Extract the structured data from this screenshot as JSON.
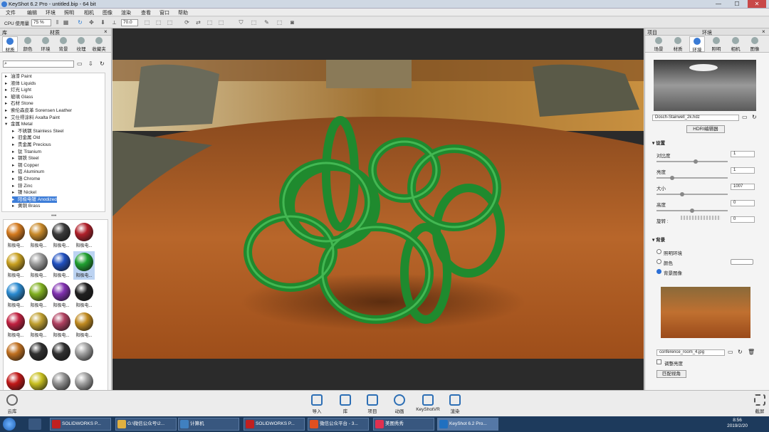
{
  "window": {
    "title": "KeyShot 6.2 Pro - untitled.bip - 64 bit",
    "min": "—",
    "max": "☐",
    "close": "✕"
  },
  "menu": [
    "文件",
    "编辑",
    "环境",
    "照明",
    "相机",
    "图像",
    "渲染",
    "查看",
    "窗口",
    "帮助"
  ],
  "toolbar": {
    "cpu_label": "CPU 使用量",
    "cpu_value": "75 %",
    "zoom_value": "70.0"
  },
  "left_panel": {
    "header_lib": "库",
    "header_title": "材质",
    "tabs": [
      "材质",
      "颜色",
      "环境",
      "背景",
      "纹理",
      "收藏夹"
    ],
    "tree": [
      {
        "label": "油漆 Paint",
        "indent": 1
      },
      {
        "label": "液体 Liquids",
        "indent": 1
      },
      {
        "label": "灯光 Light",
        "indent": 1
      },
      {
        "label": "玻璃 Glass",
        "indent": 1
      },
      {
        "label": "石材 Stone",
        "indent": 1
      },
      {
        "label": "索伦森皮革 Sorensen Leather",
        "indent": 1
      },
      {
        "label": "艾仕得涂料 Axalta Paint",
        "indent": 1
      },
      {
        "label": "金属 Metal",
        "indent": 1
      },
      {
        "label": "不锈钢 Stainless Steel",
        "indent": 2
      },
      {
        "label": "旧金属 Old",
        "indent": 2
      },
      {
        "label": "贵金属 Precious",
        "indent": 2
      },
      {
        "label": "钛 Titanium",
        "indent": 2
      },
      {
        "label": "钢铁 Steel",
        "indent": 2
      },
      {
        "label": "铜 Copper",
        "indent": 2
      },
      {
        "label": "铝 Aluminum",
        "indent": 2
      },
      {
        "label": "铬 Chrome",
        "indent": 2
      },
      {
        "label": "锌 Zinc",
        "indent": 2
      },
      {
        "label": "镍 Nickel",
        "indent": 2
      },
      {
        "label": "阳极电镀 Anodized",
        "indent": 2,
        "selected": true
      },
      {
        "label": "黄铜 Brass",
        "indent": 2
      }
    ],
    "swatches": [
      {
        "label": "阳极电...",
        "color": "#d47a1e"
      },
      {
        "label": "阳极电...",
        "color": "#c98a2a"
      },
      {
        "label": "阳极电...",
        "color": "#3a3a3a"
      },
      {
        "label": "阳极电...",
        "color": "#b0202a"
      },
      {
        "label": "阳极电...",
        "color": "#c8a020"
      },
      {
        "label": "阳极电...",
        "color": "#9a9a9a"
      },
      {
        "label": "阳极电...",
        "color": "#2050c0"
      },
      {
        "label": "阳极电...",
        "color": "#20a030",
        "selected": true
      },
      {
        "label": "阳极电...",
        "color": "#2a8ad0"
      },
      {
        "label": "阳极电...",
        "color": "#80b020"
      },
      {
        "label": "阳极电...",
        "color": "#8030b0"
      },
      {
        "label": "阳极电...",
        "color": "#202020"
      },
      {
        "label": "阳极电...",
        "color": "#c02040"
      },
      {
        "label": "阳极电...",
        "color": "#c0a030"
      },
      {
        "label": "阳极电...",
        "color": "#b04060"
      },
      {
        "label": "阳极电...",
        "color": "#c08a20"
      },
      {
        "label": "",
        "color": "#c07020"
      },
      {
        "label": "",
        "color": "#303030"
      },
      {
        "label": "",
        "color": "#303030"
      },
      {
        "label": "",
        "color": "#a0a0a0"
      },
      {
        "label": "",
        "color": "#c01818"
      },
      {
        "label": "",
        "color": "#c8c020"
      },
      {
        "label": "",
        "color": "#909090"
      },
      {
        "label": "",
        "color": "#a0a0a0"
      }
    ]
  },
  "right_panel": {
    "header_proj": "项目",
    "header_title": "环境",
    "tabs": [
      "场景",
      "材质",
      "环境",
      "照明",
      "相机",
      "图像"
    ],
    "hdri_file": "Dosch-Stairwell_2k.hdz",
    "hdri_editor": "HDRI编辑器",
    "settings_title": "设置",
    "settings": [
      {
        "label": "对比度",
        "value": "1",
        "knob": 0.55
      },
      {
        "label": "亮度",
        "value": "1",
        "knob": 0.2
      },
      {
        "label": "大小",
        "value": "1007",
        "knob": 0.35
      },
      {
        "label": "高度",
        "value": "0",
        "knob": 0.5
      },
      {
        "label": "旋转 :",
        "value": "0",
        "knob": 0.5
      }
    ],
    "bg_title": "背景",
    "bg_options": [
      {
        "label": "照明环境",
        "on": false
      },
      {
        "label": "颜色",
        "on": false
      },
      {
        "label": "背景图像",
        "on": true
      }
    ],
    "bg_file": "conference_room_4.jpg",
    "adjust_label": "调整亮度",
    "match_button": "匹配视角"
  },
  "bottom": {
    "library": "云库",
    "buttons": [
      "导入",
      "库",
      "项目",
      "动画",
      "KeyShotVR",
      "渲染"
    ],
    "screenshot": "截屏"
  },
  "taskbar": {
    "items": [
      {
        "label": "SOLIDWORKS P...",
        "color": "#c02020"
      },
      {
        "label": "G:\\微信公众号\\2...",
        "color": "#e0b040"
      },
      {
        "label": "计算机",
        "color": "#4080c0"
      },
      {
        "label": "SOLIDWORKS P...",
        "color": "#c02020"
      },
      {
        "label": "微信公众平台 - 3...",
        "color": "#e05020"
      },
      {
        "label": "美图秀秀",
        "color": "#e03050"
      },
      {
        "label": "KeyShot 6.2 Pro...",
        "color": "#2070c0"
      }
    ],
    "time": "8:56",
    "date": "2019/2/20"
  }
}
